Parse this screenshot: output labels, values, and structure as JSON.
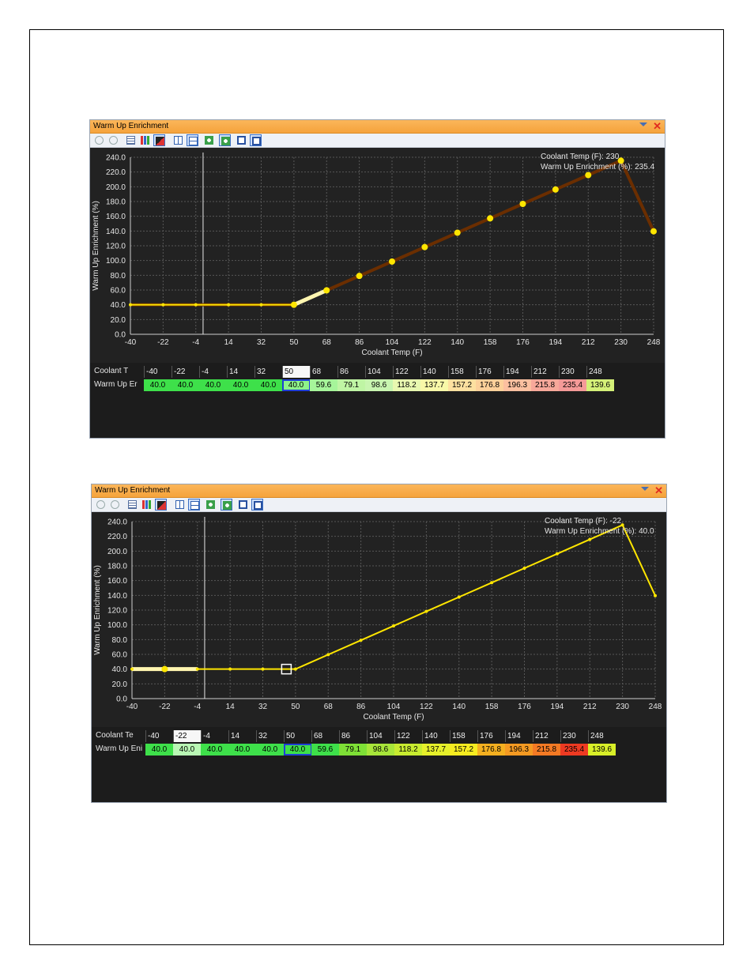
{
  "windows": [
    {
      "title": "Warm Up Enrichment",
      "readout": {
        "x_line": "Coolant Temp (F): 230",
        "y_line": "Warm Up Enrichment (%): 235.4"
      },
      "selected_header_index": 5,
      "current_cell_index": 5,
      "line_color": "#6b2e00",
      "highlight_segment": [
        5,
        6
      ],
      "row_labels": {
        "x": "Coolant T",
        "y": "Warm Up Er"
      },
      "cell_colors": [
        "#3ee04a",
        "#3ee04a",
        "#3ee04a",
        "#3ee04a",
        "#3ee04a",
        "#8ef28a",
        "#a6f59a",
        "#bff5a4",
        "#c8f5b0",
        "#e8f8b0",
        "#f8f8a8",
        "#fde0a0",
        "#fcd09a",
        "#fcc0a0",
        "#f7a89a",
        "#f49a98",
        "#d4f078"
      ]
    },
    {
      "title": "Warm Up Enrichment",
      "readout": {
        "x_line": "Coolant Temp (F): -22",
        "y_line": "Warm Up Enrichment (%): 40.0"
      },
      "selected_header_index": 1,
      "current_cell_index": 5,
      "line_color": "#ffe600",
      "highlight_segment": [
        0,
        2
      ],
      "row_labels": {
        "x": "Coolant Te",
        "y": "Warm Up Eni"
      },
      "cell_colors": [
        "#3ee04a",
        "#b9f7b4",
        "#3ee04a",
        "#3ee04a",
        "#3ee04a",
        "#3ee04a",
        "#3ee04a",
        "#7ee036",
        "#a8e63a",
        "#c8ec30",
        "#e6f02a",
        "#f6ec20",
        "#f4b020",
        "#f49a22",
        "#f47a24",
        "#ee3a22",
        "#d8ef28"
      ]
    }
  ],
  "chart_data": [
    {
      "type": "line",
      "xlabel": "Coolant Temp (F)",
      "ylabel": "Warm Up Enrichment (%)",
      "x": [
        -40,
        -22,
        -4,
        14,
        32,
        50,
        68,
        86,
        104,
        122,
        140,
        158,
        176,
        194,
        212,
        230,
        248
      ],
      "series": [
        {
          "values": [
            40.0,
            40.0,
            40.0,
            40.0,
            40.0,
            40.0,
            59.6,
            79.1,
            98.6,
            118.2,
            137.7,
            157.2,
            176.8,
            196.3,
            215.8,
            235.4,
            139.6
          ]
        }
      ],
      "x_ticks": [
        "-40",
        "-22",
        "-4",
        "14",
        "32",
        "50",
        "68",
        "86",
        "104",
        "122",
        "140",
        "158",
        "176",
        "194",
        "212",
        "230",
        "248"
      ],
      "y_ticks": [
        "0.0",
        "20.0",
        "40.0",
        "60.0",
        "80.0",
        "100.0",
        "120.0",
        "140.0",
        "160.0",
        "180.0",
        "200.0",
        "220.0",
        "240.0"
      ],
      "ylim": [
        0,
        240
      ],
      "cursor_x": 0,
      "grid": true
    },
    {
      "type": "line",
      "xlabel": "Coolant Temp (F)",
      "ylabel": "Warm Up Enrichment (%)",
      "x": [
        -40,
        -22,
        -4,
        14,
        32,
        50,
        68,
        86,
        104,
        122,
        140,
        158,
        176,
        194,
        212,
        230,
        248
      ],
      "series": [
        {
          "values": [
            40.0,
            40.0,
            40.0,
            40.0,
            40.0,
            40.0,
            59.6,
            79.1,
            98.6,
            118.2,
            137.7,
            157.2,
            176.8,
            196.3,
            215.8,
            235.4,
            139.6
          ]
        }
      ],
      "x_ticks": [
        "-40",
        "-22",
        "-4",
        "14",
        "32",
        "50",
        "68",
        "86",
        "104",
        "122",
        "140",
        "158",
        "176",
        "194",
        "212",
        "230",
        "248"
      ],
      "y_ticks": [
        "0.0",
        "20.0",
        "40.0",
        "60.0",
        "80.0",
        "100.0",
        "120.0",
        "140.0",
        "160.0",
        "180.0",
        "200.0",
        "220.0",
        "240.0"
      ],
      "ylim": [
        0,
        240
      ],
      "cursor_x": 0,
      "grid": true
    }
  ],
  "table": {
    "headers": [
      "-40",
      "-22",
      "-4",
      "14",
      "32",
      "50",
      "68",
      "86",
      "104",
      "122",
      "140",
      "158",
      "176",
      "194",
      "212",
      "230",
      "248"
    ],
    "values": [
      "40.0",
      "40.0",
      "40.0",
      "40.0",
      "40.0",
      "40.0",
      "59.6",
      "79.1",
      "98.6",
      "118.2",
      "137.7",
      "157.2",
      "176.8",
      "196.3",
      "215.8",
      "235.4",
      "139.6"
    ]
  },
  "toolbar_icons": [
    "undo-icon",
    "redo-icon",
    "table-view-icon",
    "bar-chart-icon",
    "chart-table-icon",
    "split-vertical-icon",
    "split-horizontal-icon",
    "expand-icon",
    "fit-icon",
    "zoom-select-icon",
    "zoom-fit-icon"
  ]
}
